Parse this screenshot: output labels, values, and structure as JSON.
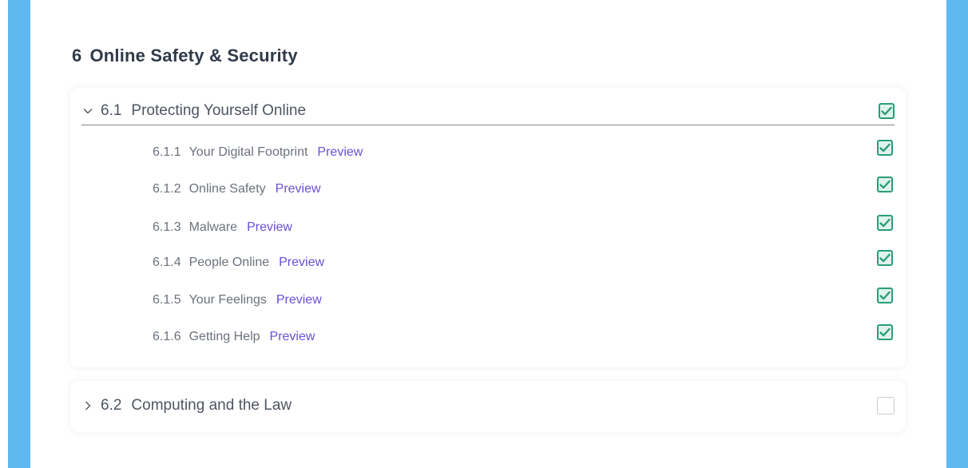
{
  "section": {
    "number": "6",
    "title": "Online Safety & Security"
  },
  "units": [
    {
      "number": "6.1",
      "title": "Protecting Yourself Online",
      "expanded": true,
      "completed": true,
      "lessons": [
        {
          "number": "6.1.1",
          "title": "Your Digital Footprint",
          "preview": "Preview",
          "completed": true
        },
        {
          "number": "6.1.2",
          "title": "Online Safety",
          "preview": "Preview",
          "completed": true
        },
        {
          "number": "6.1.3",
          "title": "Malware",
          "preview": "Preview",
          "completed": true
        },
        {
          "number": "6.1.4",
          "title": "People Online",
          "preview": "Preview",
          "completed": true
        },
        {
          "number": "6.1.5",
          "title": "Your Feelings",
          "preview": "Preview",
          "completed": true
        },
        {
          "number": "6.1.6",
          "title": "Getting Help",
          "preview": "Preview",
          "completed": true
        }
      ]
    },
    {
      "number": "6.2",
      "title": "Computing and the Law",
      "expanded": false,
      "completed": false,
      "lessons": []
    }
  ],
  "colors": {
    "side_bar": "#5fb8ef",
    "check_border": "#2a9d77",
    "check_fill": "#dff3ec",
    "preview_link": "#6a4fd6"
  },
  "icons": {
    "expanded": "chevron-down-icon",
    "collapsed": "chevron-right-icon",
    "checked": "checkmark-icon"
  }
}
